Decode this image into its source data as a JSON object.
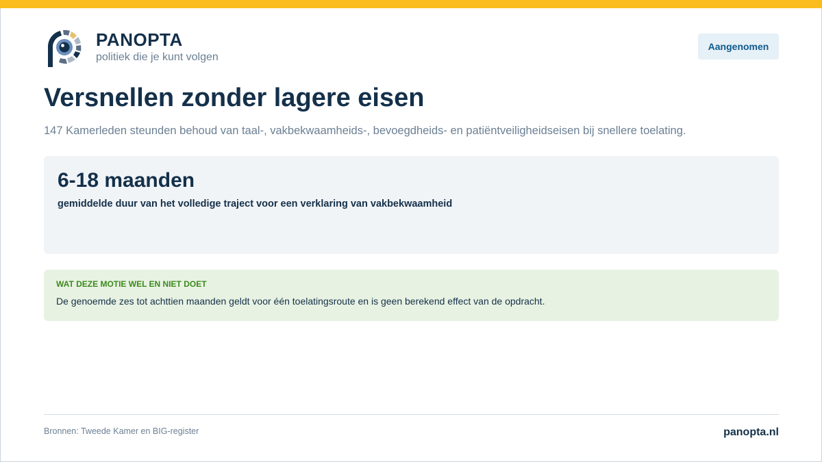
{
  "brand": {
    "name": "PANOPTA",
    "tagline": "politiek die je kunt volgen"
  },
  "header": {
    "status_badge": "Aangenomen"
  },
  "main": {
    "title": "Versnellen zonder lagere eisen",
    "lead": "147 Kamerleden steunden behoud van taal-, vakbekwaamheids-, bevoegdheids- en patiëntveiligheidseisen bij snellere toelating.",
    "stat": {
      "value": "6-18 maanden",
      "label": "gemiddelde duur van het volledige traject voor een verklaring van vakbekwaamheid"
    },
    "note": {
      "heading": "WAT DEZE MOTIE WEL EN NIET DOET",
      "text": "De genoemde zes tot achttien maanden geldt voor één toelatingsroute en is geen berekend effect van de opdracht."
    }
  },
  "footer": {
    "sources": "Bronnen: Tweede Kamer en BIG-register",
    "site": "panopta.nl"
  },
  "colors": {
    "accent_bar": "#fbbd1d",
    "brand_navy": "#14304a",
    "badge_bg": "#e6f0f7",
    "note_bg": "#e8f2e2",
    "note_heading": "#3c8a1e"
  },
  "icons": {
    "logo": "panopta-eye-logo"
  }
}
